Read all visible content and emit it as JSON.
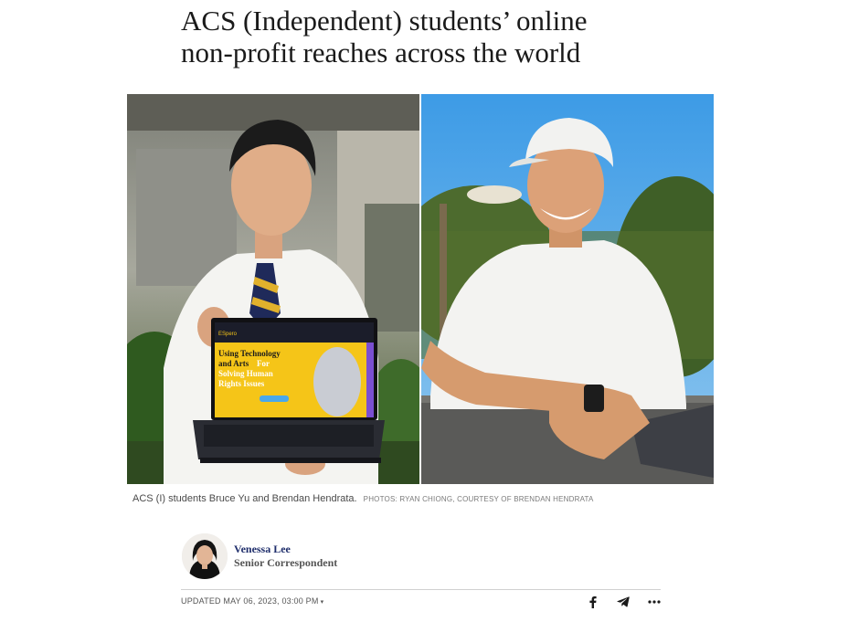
{
  "article": {
    "headline_line1": "ACS (Independent) students’ online",
    "headline_line2": "non-profit reaches across the world"
  },
  "photos": {
    "caption_text": "ACS (I) students Bruce Yu and Brendan Hendrata.",
    "caption_credit": "PHOTOS: RYAN CHIONG, COURTESY OF BRENDAN HENDRATA",
    "laptop_screen": {
      "brand": "ESpero",
      "headline_part1": "Using Technology",
      "headline_part2": "and Arts",
      "headline_part3": "For",
      "headline_part4": "Solving Human",
      "headline_part5": "Rights Issues"
    }
  },
  "author": {
    "name": "Venessa Lee",
    "role": "Senior Correspondent"
  },
  "meta": {
    "updated": "UPDATED MAY 06, 2023, 03:00 PM",
    "caret": "▾"
  },
  "share": {
    "icons": [
      "facebook-icon",
      "telegram-icon",
      "more-icon"
    ]
  },
  "colors": {
    "author_name": "#1e2d6b",
    "laptop_screen_yellow": "#f5c518",
    "sky_blue": "#4aa8ea"
  }
}
